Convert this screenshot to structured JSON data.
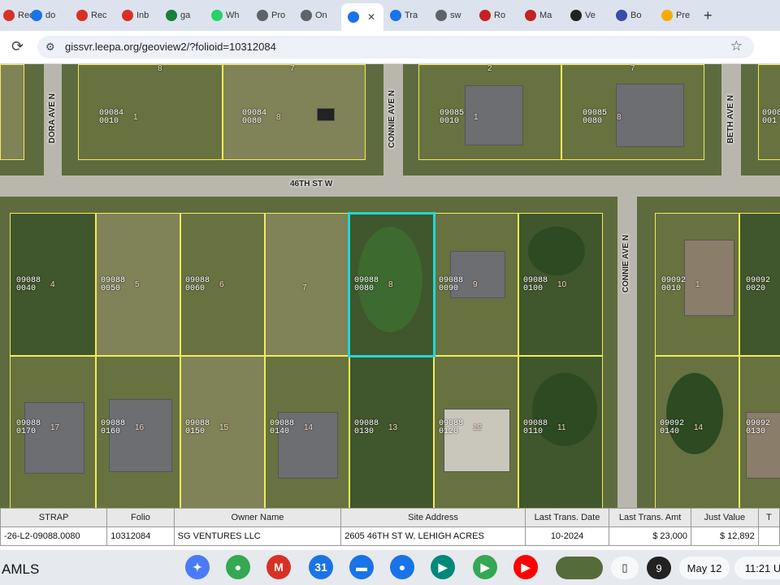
{
  "browser": {
    "tabs": [
      {
        "label": "Rec",
        "icon": "tab-icon-red",
        "color": "#d93025"
      },
      {
        "label": "do",
        "icon": "tab-icon-emoji",
        "color": "#1a73e8"
      },
      {
        "label": "Rec",
        "icon": "gmail-icon",
        "color": "#d93025"
      },
      {
        "label": "Inb",
        "icon": "gmail-icon",
        "color": "#d93025"
      },
      {
        "label": "ga",
        "icon": "sheets-icon",
        "color": "#188038"
      },
      {
        "label": "Wh",
        "icon": "whatsapp-icon",
        "color": "#25d366"
      },
      {
        "label": "Pro",
        "icon": "globe-icon",
        "color": "#5f6368"
      },
      {
        "label": "On",
        "icon": "globe-icon",
        "color": "#5f6368"
      },
      {
        "label": "",
        "icon": "globe-icon",
        "color": "#1a73e8",
        "active": true
      },
      {
        "label": "Tra",
        "icon": "translate-icon",
        "color": "#1a73e8"
      },
      {
        "label": "sw",
        "icon": "globe-icon",
        "color": "#5f6368"
      },
      {
        "label": "Ro",
        "icon": "c-icon",
        "color": "#c5221f"
      },
      {
        "label": "Ma",
        "icon": "c-icon",
        "color": "#c5221f"
      },
      {
        "label": "Ve",
        "icon": "openai-icon",
        "color": "#222222"
      },
      {
        "label": "Bo",
        "icon": "globe-icon",
        "color": "#3c4ba8"
      },
      {
        "label": "Pre",
        "icon": "triangle-icon",
        "color": "#f9ab00"
      }
    ],
    "new_tab": "+",
    "url": "gissvr.leepa.org/geoview2/?folioid=10312084",
    "reload": "⟳",
    "site_info": "⚙",
    "bookmark": "☆"
  },
  "map": {
    "roads": {
      "street": "46TH ST W",
      "dora": "DORA AVE N",
      "connie_top": "CONNIE AVE N",
      "connie_right": "CONNIE AVE N",
      "beth": "BETH AVE N"
    },
    "lots": [
      {
        "strap": "09084\n0010",
        "num": "1"
      },
      {
        "strap": "09084\n0080",
        "num": "8"
      },
      {
        "strap": "09085\n0010",
        "num": "1"
      },
      {
        "strap": "09085\n0080",
        "num": "8"
      },
      {
        "strap": "09088\n0040",
        "num": "4"
      },
      {
        "strap": "09088\n0050",
        "num": "5"
      },
      {
        "strap": "09088\n0060",
        "num": "6"
      },
      {
        "strap": "",
        "num": "7"
      },
      {
        "strap": "09088\n0080",
        "num": "8"
      },
      {
        "strap": "09088\n0090",
        "num": "9"
      },
      {
        "strap": "09088\n0100",
        "num": "10"
      },
      {
        "strap": "09092\n0010",
        "num": "1"
      },
      {
        "strap": "09092\n0020",
        "num": ""
      },
      {
        "strap": "09088\n0170",
        "num": "17"
      },
      {
        "strap": "09088\n0160",
        "num": "16"
      },
      {
        "strap": "09088\n0150",
        "num": "15"
      },
      {
        "strap": "09088\n0140",
        "num": "14"
      },
      {
        "strap": "09088\n0130",
        "num": "13"
      },
      {
        "strap": "09088\n0120",
        "num": "12"
      },
      {
        "strap": "09088\n0110",
        "num": "11"
      },
      {
        "strap": "09092\n0140",
        "num": "14"
      },
      {
        "strap": "09092\n0130",
        "num": ""
      },
      {
        "strap": "0908\n001",
        "num": ""
      }
    ],
    "top_lot_numbers": [
      "8",
      "7",
      "2",
      "7"
    ]
  },
  "table": {
    "headers": [
      "STRAP",
      "Folio",
      "Owner Name",
      "Site Address",
      "Last Trans. Date",
      "Last Trans. Amt",
      "Just Value",
      "T"
    ],
    "row": [
      "-26-L2-09088.0080",
      "10312084",
      "SG VENTURES LLC",
      "2605 46TH ST W, LEHIGH ACRES",
      "10-2024",
      "$ 23,000",
      "$ 12,892",
      ""
    ]
  },
  "taskbar": {
    "brand": "AMLS",
    "apps": [
      {
        "name": "gemini-icon",
        "glyph": "✦",
        "color": "#4a7bf7"
      },
      {
        "name": "chrome-icon",
        "glyph": "●",
        "color": "#34a853"
      },
      {
        "name": "gmail-icon",
        "glyph": "M",
        "color": "#d93025"
      },
      {
        "name": "calendar-icon",
        "glyph": "31",
        "color": "#1a73e8"
      },
      {
        "name": "files-icon",
        "glyph": "▬",
        "color": "#1a73e8"
      },
      {
        "name": "messages-icon",
        "glyph": "●",
        "color": "#1a73e8"
      },
      {
        "name": "meet-icon",
        "glyph": "▶",
        "color": "#00897b"
      },
      {
        "name": "play-store-icon",
        "glyph": "▶",
        "color": "#34a853"
      },
      {
        "name": "youtube-icon",
        "glyph": "▶",
        "color": "#ff0000"
      }
    ],
    "notification_count": "9",
    "date": "May 12",
    "time": "11:21 U"
  }
}
